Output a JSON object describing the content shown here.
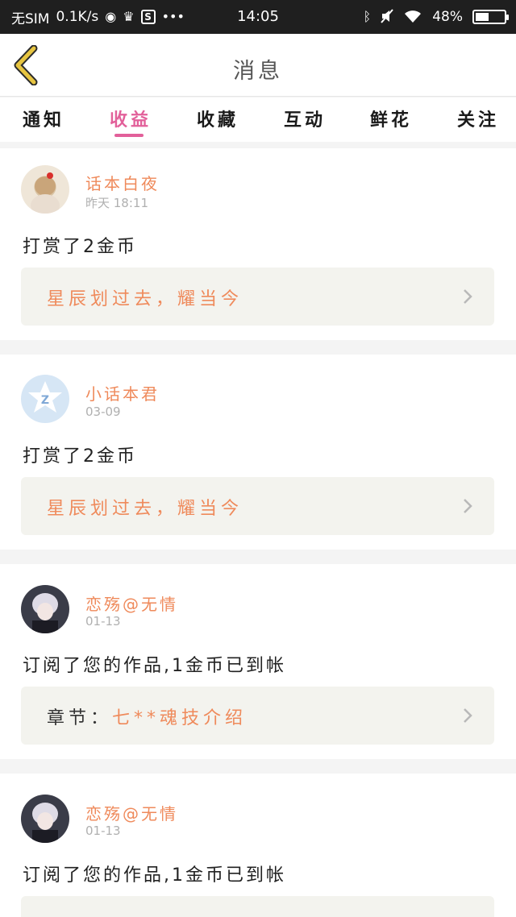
{
  "status_bar": {
    "carrier": "无SIM",
    "speed": "0.1K/s",
    "time": "14:05",
    "battery": "48%",
    "battery_level": 0.48,
    "icons": [
      "globe-icon",
      "crown-icon",
      "s-box-icon",
      "more-dots-icon",
      "bluetooth-icon",
      "mute-icon",
      "wifi-icon",
      "battery-icon"
    ]
  },
  "header": {
    "title": "消息"
  },
  "tabs": [
    {
      "label": "通知",
      "active": false
    },
    {
      "label": "收益",
      "active": true
    },
    {
      "label": "收藏",
      "active": false
    },
    {
      "label": "互动",
      "active": false
    },
    {
      "label": "鲜花",
      "active": false
    },
    {
      "label": "关注",
      "active": false
    }
  ],
  "notifications": [
    {
      "username": "话本白夜",
      "time": "昨天 18:11",
      "message": "打赏了2金币",
      "ref_prefix": "",
      "ref_text": "星辰划过去，耀当今"
    },
    {
      "username": "小话本君",
      "time": "03-09",
      "message": "打赏了2金币",
      "ref_prefix": "",
      "ref_text": "星辰划过去，耀当今"
    },
    {
      "username": "恋殇@无情",
      "time": "01-13",
      "message": "订阅了您的作品,1金币已到帐",
      "ref_prefix": "章节：",
      "ref_text": "七**魂技介绍"
    },
    {
      "username": "恋殇@无情",
      "time": "01-13",
      "message": "订阅了您的作品,1金币已到帐",
      "ref_prefix": "",
      "ref_text": ""
    }
  ],
  "colors": {
    "accent": "#e2609a",
    "username": "#ef8a5b",
    "back_arrow": "#e7c541",
    "ref_bg": "#f3f3ee"
  }
}
